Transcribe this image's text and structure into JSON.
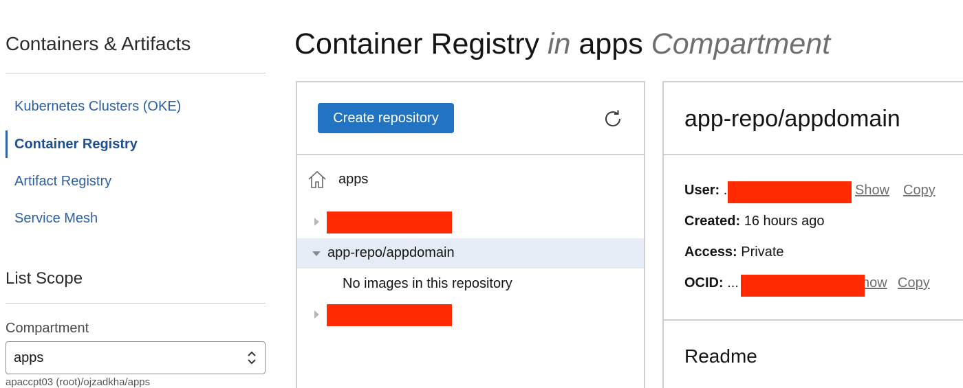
{
  "sidebar": {
    "title": "Containers & Artifacts",
    "nav": [
      {
        "label": "Kubernetes Clusters (OKE)"
      },
      {
        "label": "Container Registry"
      },
      {
        "label": "Artifact Registry"
      },
      {
        "label": "Service Mesh"
      }
    ],
    "scope_title": "List Scope",
    "compartment_label": "Compartment",
    "compartment_value": "apps",
    "compartment_path": "apaccpt03 (root)/ojzadkha/apps"
  },
  "header": {
    "part1": "Container Registry",
    "part2": " in ",
    "part3": "apps",
    "part4": " Compartment"
  },
  "tree": {
    "create_button": "Create repository",
    "refresh_icon": "refresh-icon",
    "home_icon": "home-icon",
    "root_label": "apps",
    "selected_repo": "app-repo/appdomain",
    "empty_message": "No images in this repository"
  },
  "detail": {
    "title": "app-repo/appdomain",
    "user_label": "User:",
    "user_prefix": ".",
    "created_label": "Created:",
    "created_value": "16 hours ago",
    "access_label": "Access:",
    "access_value": "Private",
    "ocid_label": "OCID:",
    "ocid_prefix": "...",
    "show_link": "Show",
    "show_link_partial": "how",
    "copy_link": "Copy",
    "readme_title": "Readme"
  },
  "colors": {
    "accent": "#2274c2",
    "nav_link": "#2b5fa4",
    "redaction": "#ff2a00",
    "selected_row": "#e5ecf5"
  }
}
